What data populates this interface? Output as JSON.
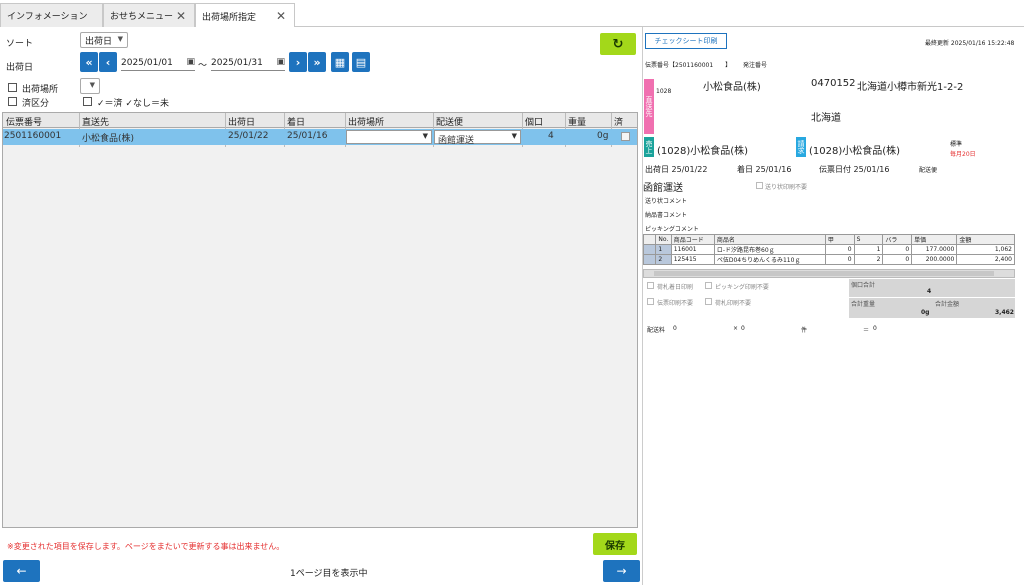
{
  "tabs": [
    {
      "label": "インフォメーション",
      "active": false,
      "closable": false
    },
    {
      "label": "おせちメニュー",
      "active": false,
      "closable": true
    },
    {
      "label": "出荷場所指定",
      "active": true,
      "closable": true
    }
  ],
  "filters": {
    "sort_label": "ソート",
    "sort_value": "出荷日",
    "ship_date_label": "出荷日",
    "date_from": "2025/01/01",
    "date_sep": "〜",
    "date_to": "2025/01/31",
    "ship_place_label": "出荷場所",
    "done_label": "済区分",
    "done_hint": "✓＝済 ✓なし＝未"
  },
  "grid": {
    "columns": [
      "伝票番号",
      "直送先",
      "出荷日",
      "着日",
      "出荷場所",
      "配送便",
      "個口",
      "重量",
      "済"
    ],
    "rows": [
      {
        "slip": "2501160001",
        "dest": "小松食品(株)",
        "ship": "25/01/22",
        "arrive": "25/01/16",
        "place": "",
        "carrier": "函館運送",
        "pieces": "4",
        "weight": "0g",
        "done": ""
      }
    ]
  },
  "footer": {
    "note": "※変更された項目を保存します。ページをまたいで更新する事は出来ません。",
    "save_label": "保存",
    "page_status": "1ページ目を表示中"
  },
  "slip": {
    "print_label": "チェックシート印刷",
    "updated": "最終更新 2025/01/16 15:22:48",
    "slip_no": "伝票番号【2501160001　　】",
    "issue_no": "発注番号",
    "dest_tag": "直送先",
    "dest_code": "1028",
    "dest_name": "小松食品(株)",
    "postal": "0470152",
    "address": "北海道小樽市新光1-2-2",
    "pref": "北海道",
    "sale_tag": "売上",
    "sale_name": "(1028)小松食品(株)",
    "bill_tag": "請求",
    "bill_name": "(1028)小松食品(株)",
    "std_label": "標準",
    "cutoff": "毎月20日",
    "ship_date": "出荷日 25/01/22",
    "arrive_date": "着日 25/01/16",
    "slip_date": "伝票日付 25/01/16",
    "delivery_label": "配送便",
    "carrier": "函館運送",
    "no_label_print": "送り状印刷不要",
    "label_comment": "送り状コメント",
    "delivery_comment": "納品書コメント",
    "picking_comment": "ピッキングコメント",
    "item_columns": [
      "No.",
      "商品コード",
      "商品名",
      "甲",
      "S",
      "バラ",
      "単価",
      "金額"
    ],
    "items": [
      {
        "no": "1",
        "code": "116001",
        "name": "ロ-ド汐路昆布巻60ｇ",
        "a": "0",
        "s": "1",
        "bara": "0",
        "price": "177.0000",
        "amount": "1,062"
      },
      {
        "no": "2",
        "code": "125415",
        "name": "ペ伍D04ちりめんくるみ110ｇ",
        "a": "0",
        "s": "2",
        "bara": "0",
        "price": "200.0000",
        "amount": "2,400"
      }
    ],
    "opt_tag_day": "荷札着日印刷",
    "opt_picking": "ピッキング印刷不要",
    "opt_slip": "伝票印刷不要",
    "opt_tag": "荷札印刷不要",
    "pieces_label": "個口合計",
    "pieces_value": "4",
    "weight_label": "合計重量",
    "weight_value": "0g",
    "amount_label": "合計金額",
    "amount_value": "3,462",
    "shipping_fee": "配送料",
    "fee_value": "0",
    "times": "×",
    "times_value": "0",
    "unit": "件",
    "equals": "＝",
    "total_value": "0"
  }
}
